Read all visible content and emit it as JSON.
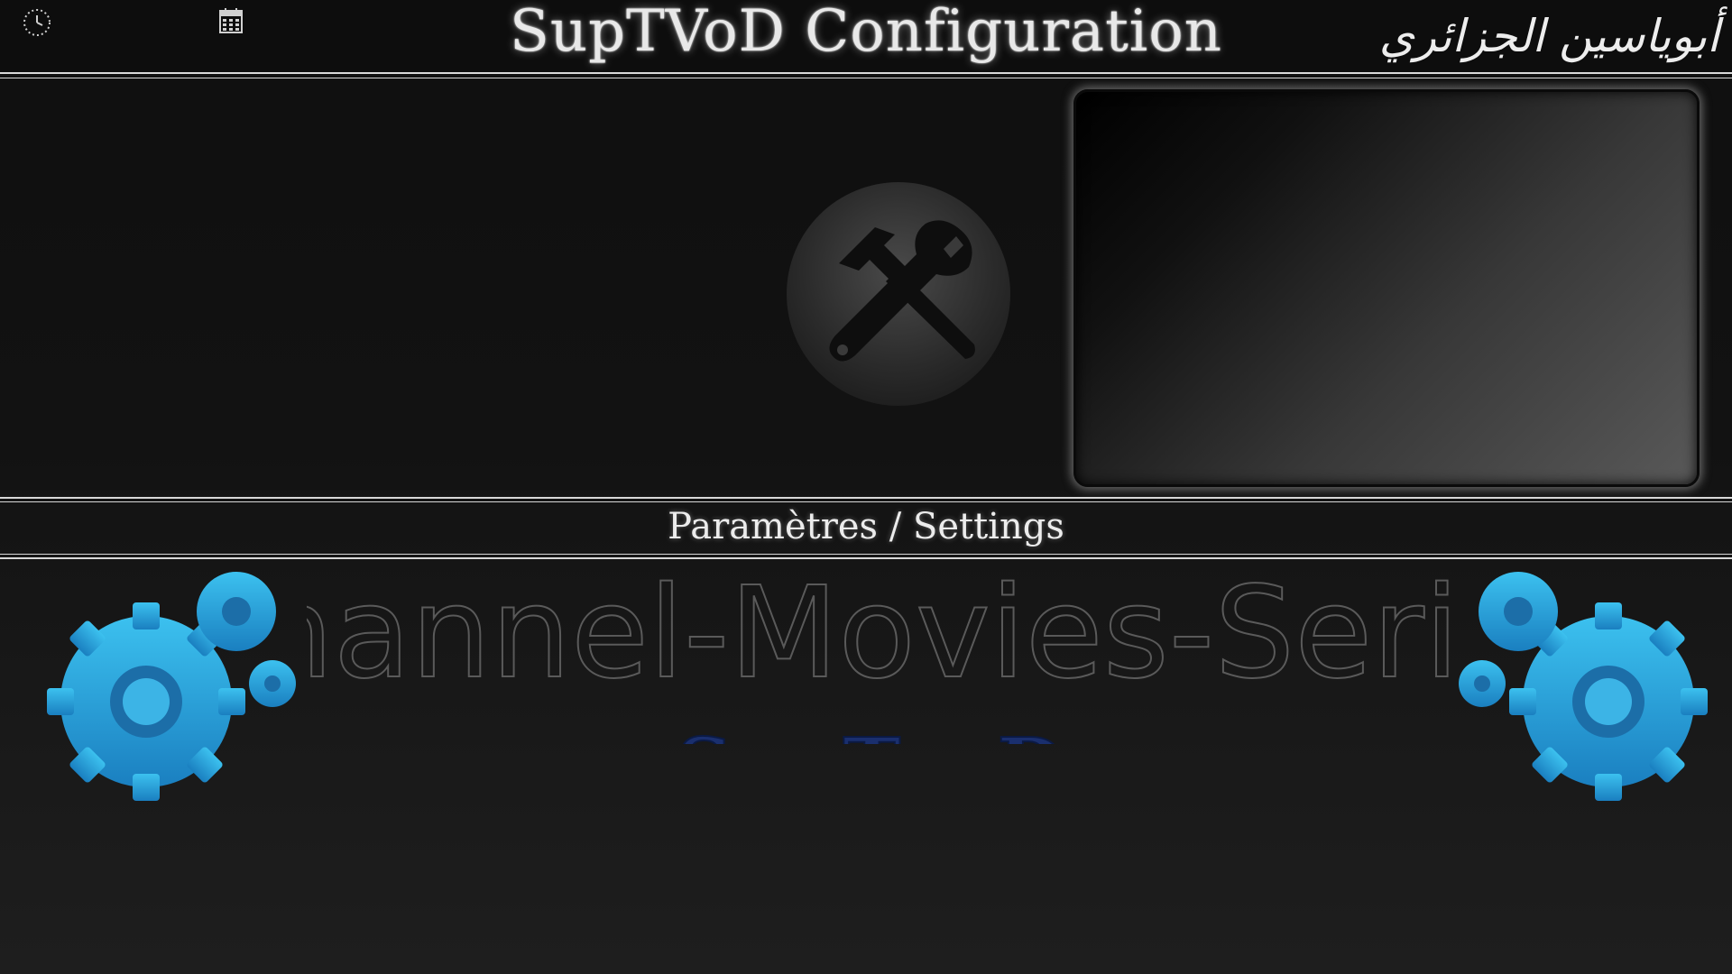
{
  "header": {
    "title": "SupTVoD Configuration",
    "author": "أبوياسين الجزائري",
    "clock_icon": "clock-icon",
    "calendar_icon": "calendar-icon"
  },
  "main": {
    "selected_icon": "tools-icon",
    "preview": "preview-panel"
  },
  "footer": {
    "section_label": "Paramètres / Settings",
    "watermark_text": "Channel-Movies-Series",
    "logo_text": "SupTvoD",
    "decor_icon": "gears-icon"
  },
  "colors": {
    "background": "#161616",
    "divider": "#d8d8d8",
    "text": "#ececec",
    "gear_blue": "#2aa7dd",
    "logo_blue": "#1a2f6e"
  }
}
